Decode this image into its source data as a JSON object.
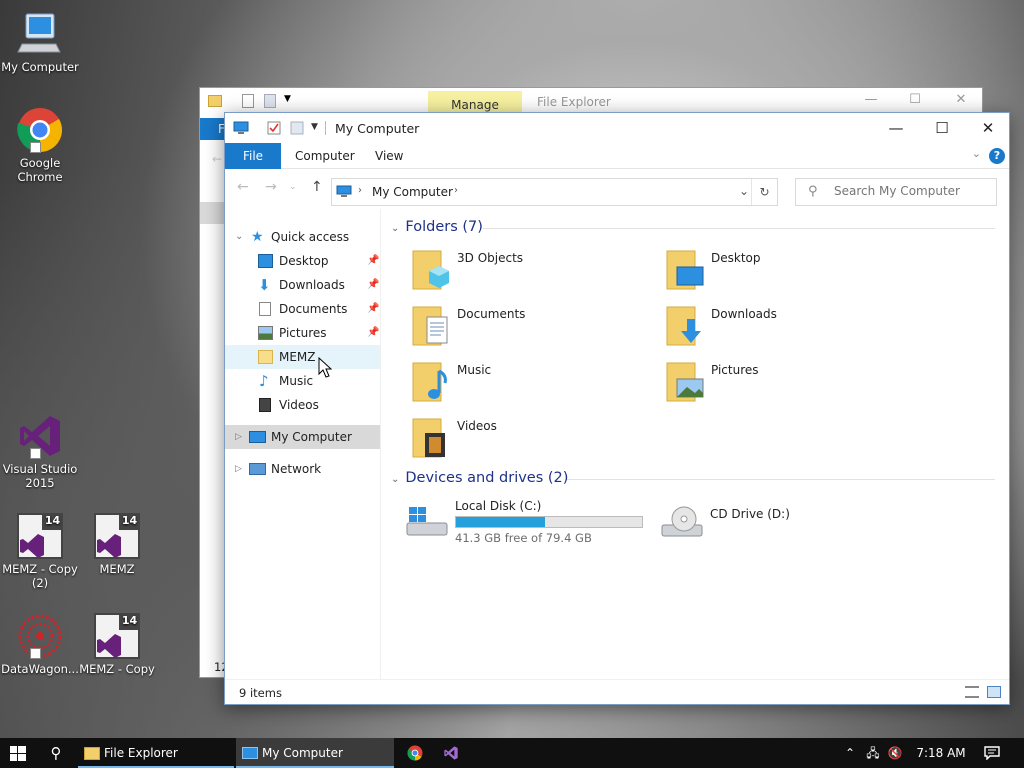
{
  "desktop": {
    "icons": [
      {
        "label": "My Computer"
      },
      {
        "label": "Google Chrome"
      },
      {
        "label": "Visual Studio 2015"
      },
      {
        "label": "MEMZ - Copy (2)"
      },
      {
        "label": "MEMZ"
      },
      {
        "label": "DataWagon..."
      },
      {
        "label": "MEMZ - Copy"
      }
    ],
    "badge_text": "14"
  },
  "back_window": {
    "manage_label": "Manage",
    "title": "File Explorer",
    "file_tab": "F",
    "status_fragment": "12"
  },
  "window": {
    "title": "My Computer",
    "ribbon": {
      "file": "File",
      "computer": "Computer",
      "view": "View",
      "help": "?"
    },
    "address": {
      "crumb": "My Computer"
    },
    "search": {
      "placeholder": "Search My Computer"
    },
    "sidebar": {
      "quick_access": "Quick access",
      "items": [
        {
          "label": "Desktop"
        },
        {
          "label": "Downloads"
        },
        {
          "label": "Documents"
        },
        {
          "label": "Pictures"
        },
        {
          "label": "MEMZ"
        },
        {
          "label": "Music"
        },
        {
          "label": "Videos"
        }
      ],
      "my_computer": "My Computer",
      "network": "Network"
    },
    "folders": {
      "heading": "Folders (7)",
      "items": [
        {
          "label": "3D Objects"
        },
        {
          "label": "Desktop"
        },
        {
          "label": "Documents"
        },
        {
          "label": "Downloads"
        },
        {
          "label": "Music"
        },
        {
          "label": "Pictures"
        },
        {
          "label": "Videos"
        }
      ]
    },
    "drives": {
      "heading": "Devices and drives (2)",
      "items": [
        {
          "label": "Local Disk (C:)",
          "free_text": "41.3 GB free of 79.4 GB",
          "used_fraction": 0.48
        },
        {
          "label": "CD Drive (D:)"
        }
      ]
    },
    "status": {
      "count": "9 items"
    }
  },
  "taskbar": {
    "tasks": [
      {
        "label": "File Explorer"
      },
      {
        "label": "My Computer"
      }
    ],
    "clock": "7:18 AM"
  },
  "colors": {
    "accent": "#1979ca",
    "folder": "#f3cf6c",
    "taskbar": "#101010",
    "drive_fill": "#26a0da"
  }
}
